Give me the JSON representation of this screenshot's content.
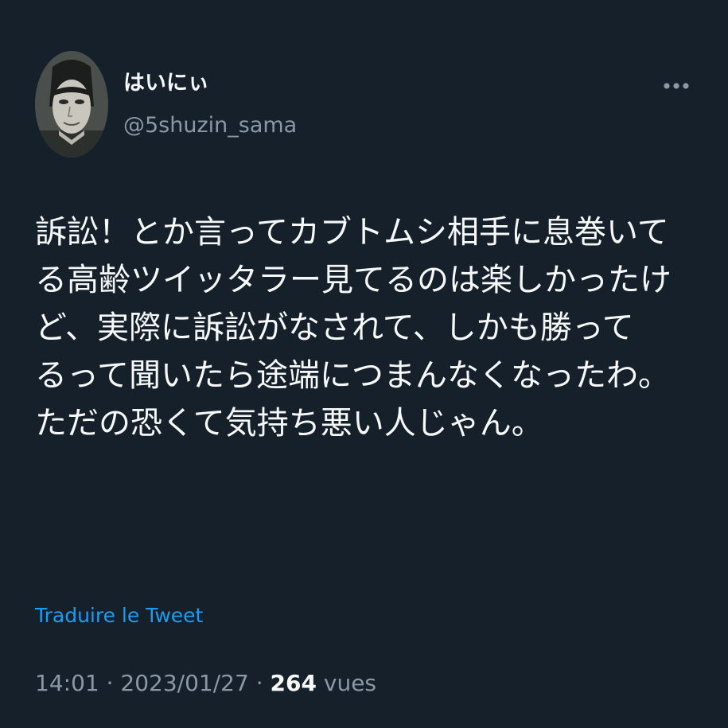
{
  "tweet": {
    "author": {
      "display_name": "はいにぃ",
      "handle": "@5shuzin_sama",
      "avatar_icon": "anime-character-avatar"
    },
    "more_icon": "more-dots-icon",
    "text_lines": [
      "訴訟！とか言ってカブトムシ相手に息巻いて",
      "る高齢ツイッタラー見てるのは楽しかったけ",
      "ど、実際に訴訟がなされて、しかも勝って",
      "るって聞いたら途端につまんなくなったわ。",
      "ただの恐くて気持ち悪い人じゃん。"
    ],
    "translate_label": "Traduire le Tweet",
    "time": "14:01",
    "separator": "·",
    "date": "2023/01/27",
    "views_count": "264",
    "views_label": "vues"
  },
  "colors": {
    "background": "#15202b",
    "text": "#f7f9f9",
    "secondary": "#8b98a5",
    "link": "#1d9bf0"
  }
}
